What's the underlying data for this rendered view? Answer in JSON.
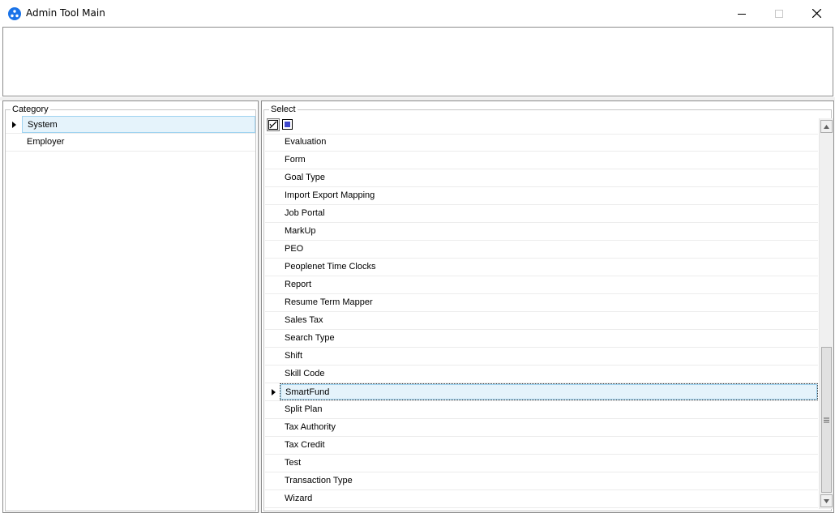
{
  "window": {
    "title": "Admin Tool Main",
    "minimize_icon": "minimize-icon",
    "maximize_icon": "maximize-icon",
    "close_icon": "close-icon"
  },
  "category": {
    "legend": "Category",
    "selected_index": 0,
    "items": [
      "System",
      "Employer"
    ]
  },
  "select": {
    "legend": "Select",
    "toolbar_icons": [
      "select-all-icon",
      "deselect-icon"
    ],
    "current_index": 14,
    "items": [
      "Evaluation",
      "Form",
      "Goal Type",
      "Import Export Mapping",
      "Job Portal",
      "MarkUp",
      "PEO",
      "Peoplenet Time Clocks",
      "Report",
      "Resume Term Mapper",
      "Sales Tax",
      "Search Type",
      "Shift",
      "Skill Code",
      "SmartFund",
      "Split Plan",
      "Tax Authority",
      "Tax Credit",
      "Test",
      "Transaction Type",
      "Wizard"
    ]
  },
  "colors": {
    "selection_bg": "#e5f3fb",
    "selection_border": "#9fd3f0",
    "app_icon": "#1a73e8"
  }
}
